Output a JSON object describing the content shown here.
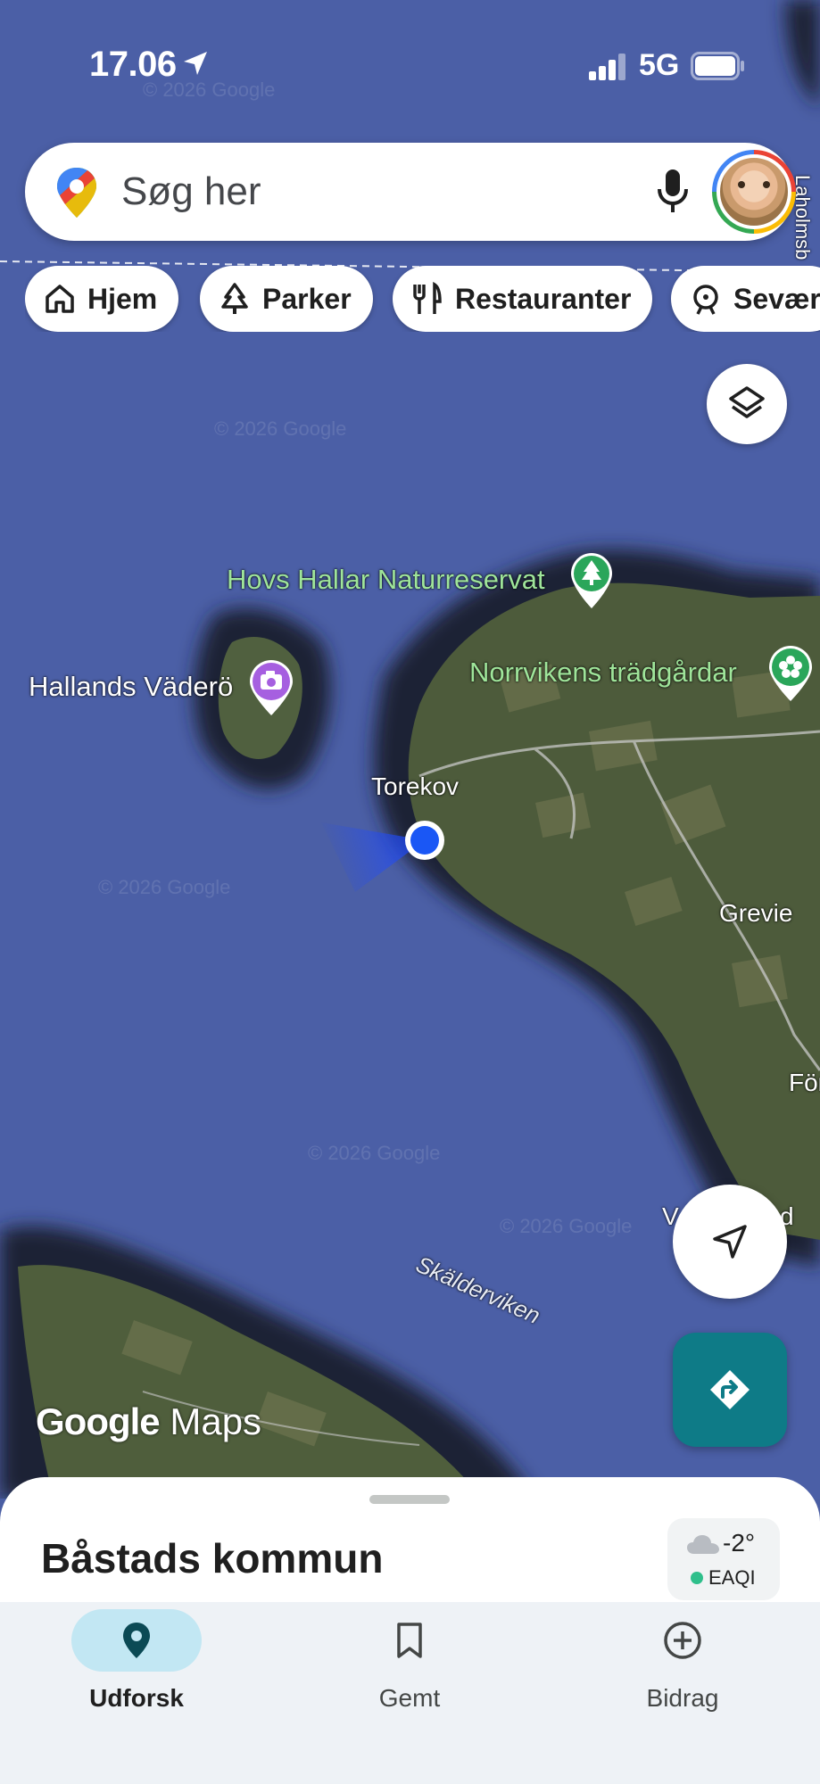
{
  "status_bar": {
    "time": "17.06",
    "network": "5G"
  },
  "search": {
    "placeholder": "Søg her"
  },
  "chips": [
    {
      "label": "Hjem",
      "icon": "home-icon"
    },
    {
      "label": "Parker",
      "icon": "tree-icon"
    },
    {
      "label": "Restauranter",
      "icon": "fork-knife-icon"
    },
    {
      "label": "Sevær",
      "icon": "attraction-icon"
    }
  ],
  "map": {
    "labels": {
      "hovs_hallar": "Hovs Hallar Naturreservat",
      "hallands_vadero": "Hallands Väderö",
      "norrvikens": "Norrvikens trädgårdar",
      "torekov": "Torekov",
      "grevie": "Grevie",
      "skalderviken": "Skälderviken",
      "laholm": "Laholmsb",
      "for": "För",
      "vd": "V",
      "vd2": "d"
    },
    "watermark": "© 2026 Google",
    "logo_google": "Google",
    "logo_maps": "Maps"
  },
  "sheet": {
    "title": "Båstads kommun",
    "weather": {
      "temp": "-2°",
      "aqi": "EAQI"
    }
  },
  "tabs": [
    {
      "label": "Udforsk",
      "icon": "location-pin-icon",
      "active": true
    },
    {
      "label": "Gemt",
      "icon": "bookmark-icon",
      "active": false
    },
    {
      "label": "Bidrag",
      "icon": "add-circle-icon",
      "active": false
    }
  ],
  "colors": {
    "water": "#4b5fa6",
    "land": "#4c5a3a",
    "accent_teal": "#0e7b87",
    "location_blue": "#1a57f5",
    "poi_green": "#9fe59a",
    "poi_purple": "#a65fe0"
  }
}
